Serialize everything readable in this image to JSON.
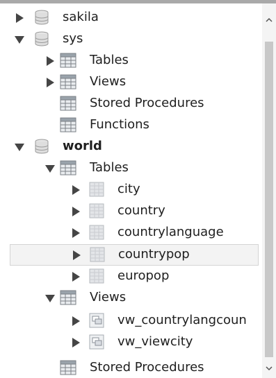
{
  "tree": {
    "schemas": [
      {
        "name": "sakila",
        "expanded": false
      },
      {
        "name": "sys",
        "expanded": true,
        "children": [
          {
            "label": "Tables",
            "expanded": false
          },
          {
            "label": "Views",
            "expanded": false
          },
          {
            "label": "Stored Procedures"
          },
          {
            "label": "Functions"
          }
        ]
      },
      {
        "name": "world",
        "expanded": true,
        "active": true,
        "tables_label": "Tables",
        "tables": [
          "city",
          "country",
          "countrylanguage",
          "countrypop",
          "europop"
        ],
        "views_label": "Views",
        "views": [
          "vw_countrylangcoun",
          "vw_viewcity"
        ],
        "stored_procedures_label": "Stored Procedures"
      }
    ],
    "highlighted_item": "countrypop"
  },
  "icons": {
    "schema": "database-icon",
    "folder": "folder-grid-icon",
    "table": "table-icon",
    "view": "view-icon"
  },
  "colors": {
    "highlight_bg": "#f3f3f3",
    "arrow": "#454545"
  }
}
